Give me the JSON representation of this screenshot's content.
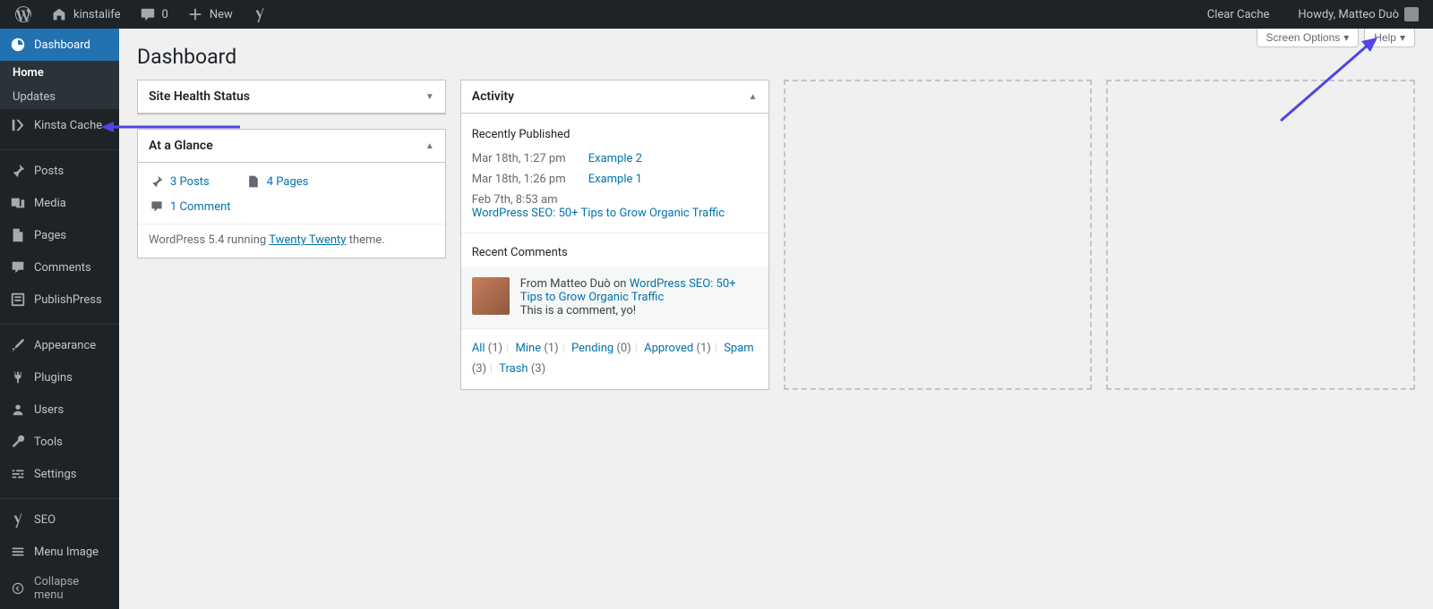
{
  "adminbar": {
    "site_name": "kinstalife",
    "comments_count": "0",
    "new_label": "New",
    "clear_cache": "Clear Cache",
    "howdy": "Howdy, Matteo Duò"
  },
  "sidebar": {
    "dashboard": "Dashboard",
    "home": "Home",
    "updates": "Updates",
    "kinsta_cache": "Kinsta Cache",
    "posts": "Posts",
    "media": "Media",
    "pages": "Pages",
    "comments": "Comments",
    "publishpress": "PublishPress",
    "appearance": "Appearance",
    "plugins": "Plugins",
    "users": "Users",
    "tools": "Tools",
    "settings": "Settings",
    "seo": "SEO",
    "menu_image": "Menu Image",
    "collapse": "Collapse menu"
  },
  "screen_meta": {
    "screen_options": "Screen Options",
    "help": "Help"
  },
  "page_title": "Dashboard",
  "widgets": {
    "site_health": {
      "title": "Site Health Status"
    },
    "glance": {
      "title": "At a Glance",
      "posts": "3 Posts",
      "pages": "4 Pages",
      "comments": "1 Comment",
      "version_pre": "WordPress 5.4 running ",
      "theme": "Twenty Twenty",
      "version_post": " theme."
    },
    "activity": {
      "title": "Activity",
      "recently_published": "Recently Published",
      "items": [
        {
          "date": "Mar 18th, 1:27 pm",
          "title": "Example 2"
        },
        {
          "date": "Mar 18th, 1:26 pm",
          "title": "Example 1"
        },
        {
          "date": "Feb 7th, 8:53 am",
          "title": "WordPress SEO: 50+ Tips to Grow Organic Traffic"
        }
      ],
      "recent_comments": "Recent Comments",
      "comment_from": "From Matteo Duò on ",
      "comment_post": "WordPress SEO: 50+ Tips to Grow Organic Traffic",
      "comment_text": "This is a comment, yo!",
      "links": {
        "all": "All",
        "all_c": " (1)",
        "mine": "Mine",
        "mine_c": " (1)",
        "pending": "Pending",
        "pending_c": " (0)",
        "approved": "Approved",
        "approved_c": " (1)",
        "spam": "Spam",
        "spam_c": " (3)",
        "trash": "Trash",
        "trash_c": " (3)"
      }
    }
  }
}
